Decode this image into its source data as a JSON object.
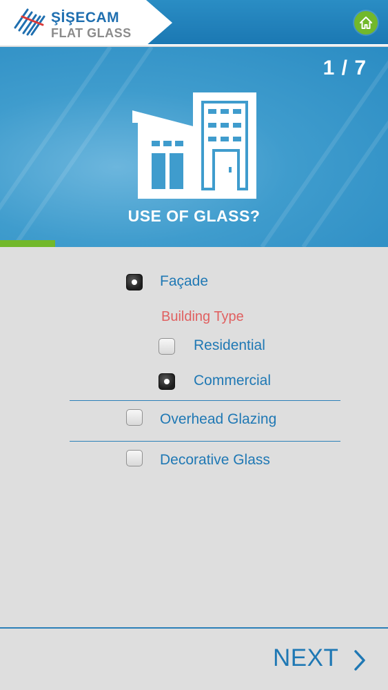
{
  "brand": {
    "line1": "ŞİŞECAM",
    "line2": "FLAT GLASS"
  },
  "header": {
    "home_icon": "home-icon"
  },
  "hero": {
    "step": "1 / 7",
    "question": "USE OF GLASS?",
    "progress_fraction": 0.142857
  },
  "options": {
    "facade": {
      "label": "Façade",
      "selected": true
    },
    "building_type_heading": "Building Type",
    "residential": {
      "label": "Residential",
      "selected": false
    },
    "commercial": {
      "label": "Commercial",
      "selected": true
    },
    "overhead": {
      "label": "Overhead Glazing",
      "selected": false
    },
    "decorative": {
      "label": "Decorative Glass",
      "selected": false
    }
  },
  "footer": {
    "next_label": "NEXT"
  },
  "colors": {
    "header_blue": "#1b78b3",
    "accent_green": "#72b82b",
    "option_text": "#1f78b4",
    "subheading_red": "#e06060",
    "background": "#dedede"
  }
}
